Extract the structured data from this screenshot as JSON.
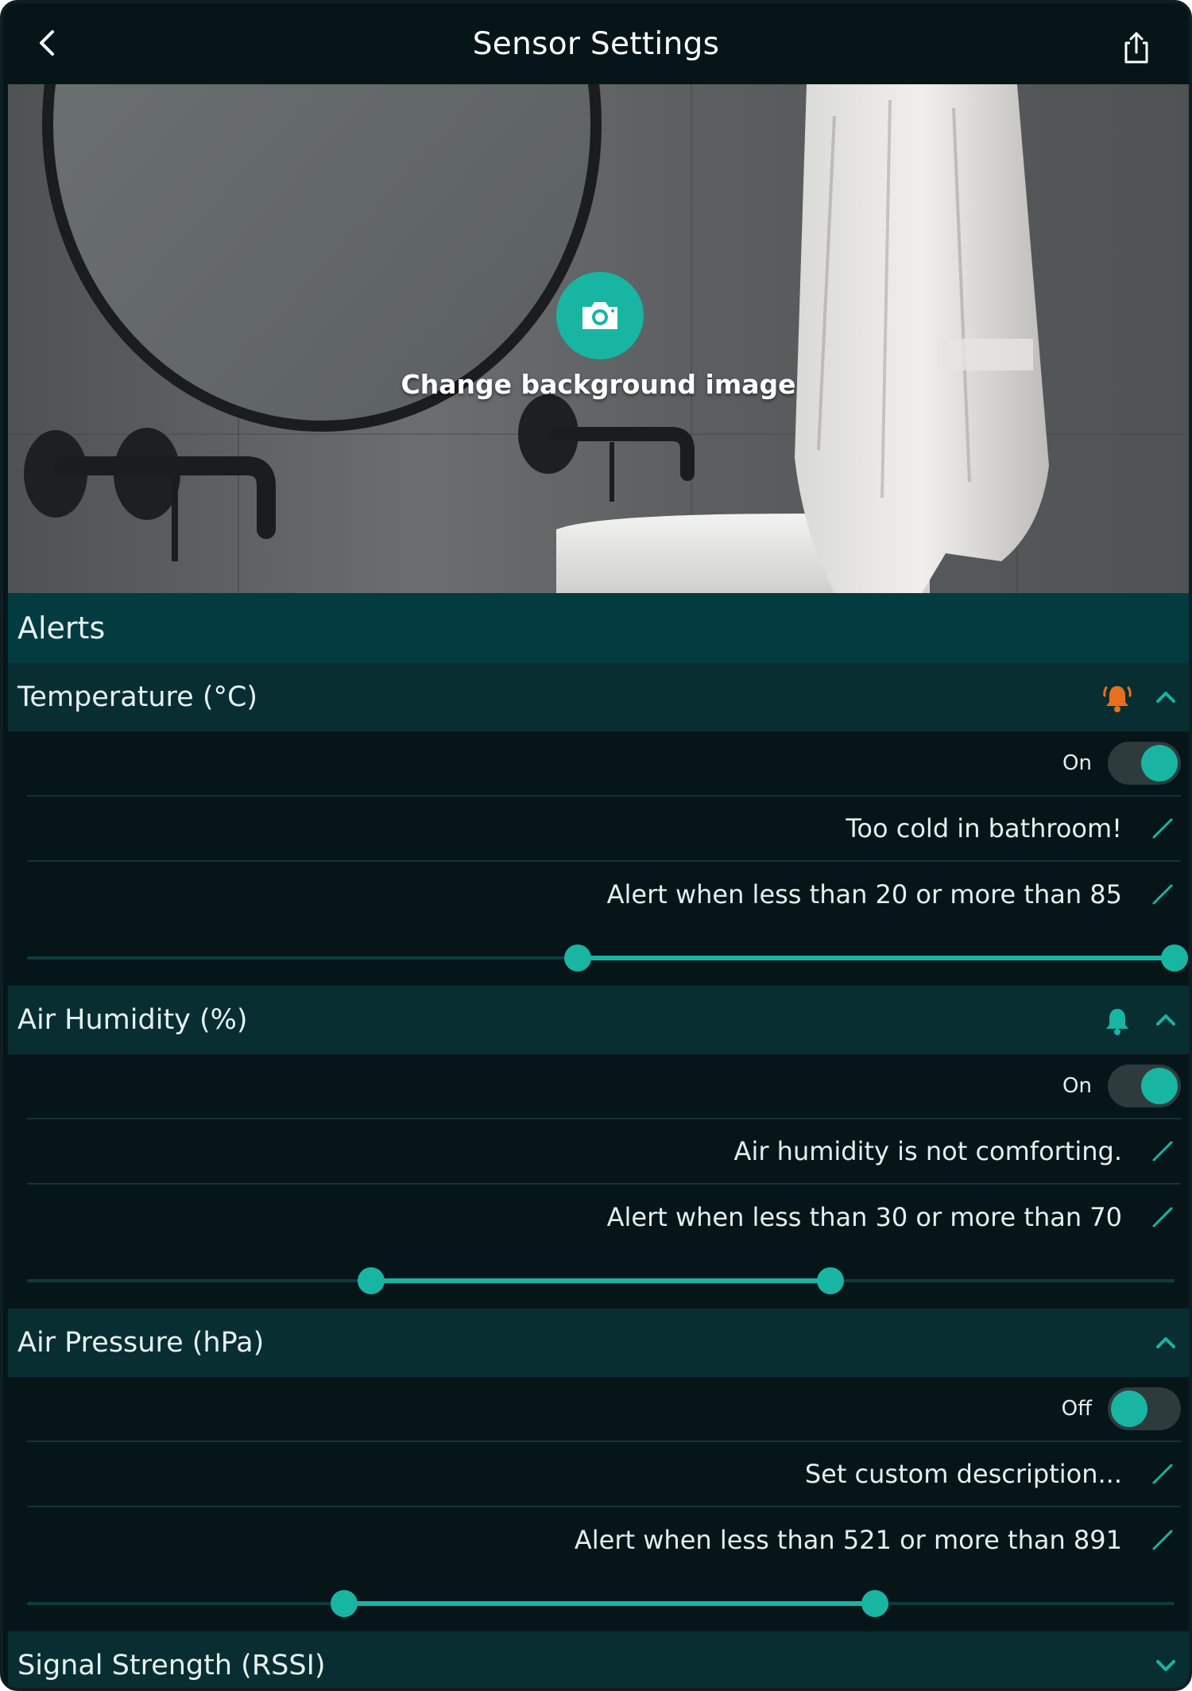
{
  "header": {
    "title": "Sensor Settings",
    "back_icon": "chevron-left-icon",
    "share_icon": "share-icon"
  },
  "hero": {
    "change_background_label": "Change background image",
    "camera_icon": "camera-icon"
  },
  "alerts": {
    "title": "Alerts",
    "sections": [
      {
        "title": "Temperature (°C)",
        "bell": "bell-ringing-icon",
        "bell_color": "#e8701c",
        "expanded": true,
        "toggle_label": "On",
        "toggle_on": true,
        "description": "Too cold in bathroom!",
        "range_text": "Alert when less than 20 or more than 85",
        "range_fraction": [
          0.48,
          1.0
        ]
      },
      {
        "title": "Air Humidity (%)",
        "bell": "bell-icon",
        "bell_color": "#17b5a2",
        "expanded": true,
        "toggle_label": "On",
        "toggle_on": true,
        "description": "Air humidity is not comforting.",
        "range_text": "Alert when less than 30 or more than 70",
        "range_fraction": [
          0.3,
          0.7
        ]
      },
      {
        "title": "Air Pressure (hPa)",
        "bell": "",
        "expanded": true,
        "toggle_label": "Off",
        "toggle_on": false,
        "description": "Set custom description...",
        "range_text": "Alert when less than 521 or more than 891",
        "range_fraction": [
          0.276,
          0.739
        ]
      },
      {
        "title": "Signal Strength (RSSI)",
        "expanded": false
      }
    ]
  },
  "colors": {
    "accent": "#17b5a2",
    "alarm": "#e8701c",
    "background": "#061618",
    "section_header": "#082e31",
    "alerts_header": "#023c40"
  }
}
